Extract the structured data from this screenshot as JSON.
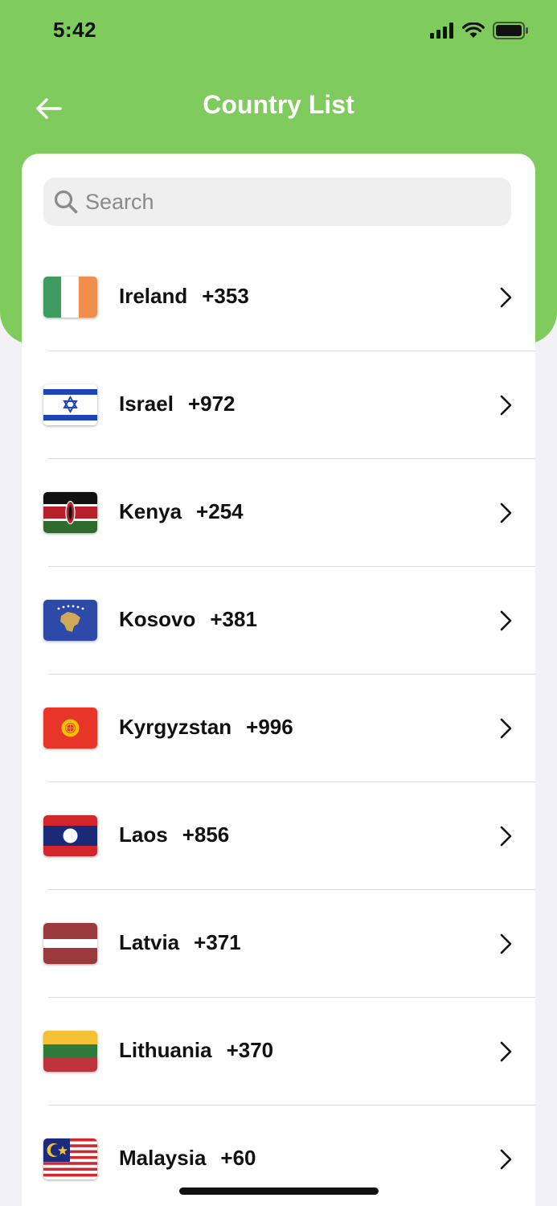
{
  "status_bar": {
    "time": "5:42"
  },
  "header": {
    "title": "Country List",
    "accent_color": "#7fcb5d"
  },
  "search": {
    "placeholder": "Search",
    "value": ""
  },
  "countries": [
    {
      "name": "Ireland",
      "code": "+353",
      "flag_icon": "ireland-flag-icon"
    },
    {
      "name": "Israel",
      "code": "+972",
      "flag_icon": "israel-flag-icon"
    },
    {
      "name": "Kenya",
      "code": "+254",
      "flag_icon": "kenya-flag-icon"
    },
    {
      "name": "Kosovo",
      "code": "+381",
      "flag_icon": "kosovo-flag-icon"
    },
    {
      "name": "Kyrgyzstan",
      "code": "+996",
      "flag_icon": "kyrgyzstan-flag-icon"
    },
    {
      "name": "Laos",
      "code": "+856",
      "flag_icon": "laos-flag-icon"
    },
    {
      "name": "Latvia",
      "code": "+371",
      "flag_icon": "latvia-flag-icon"
    },
    {
      "name": "Lithuania",
      "code": "+370",
      "flag_icon": "lithuania-flag-icon"
    },
    {
      "name": "Malaysia",
      "code": "+60",
      "flag_icon": "malaysia-flag-icon"
    }
  ]
}
